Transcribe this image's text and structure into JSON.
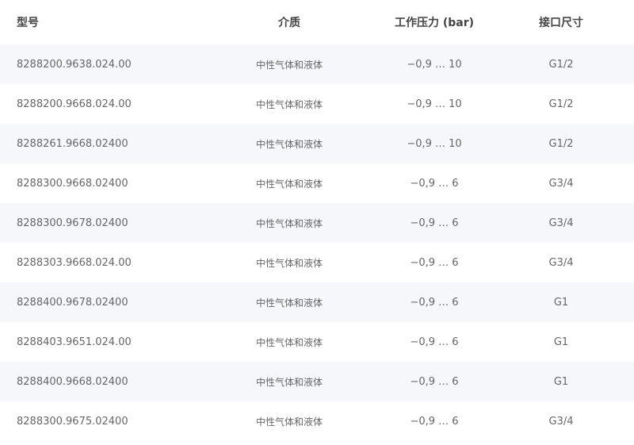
{
  "table": {
    "headers": [
      "型号",
      "介质",
      "工作压力 (bar)",
      "接口尺寸"
    ],
    "rows": [
      [
        "8288200.9638.024.00",
        "中性气体和液体",
        "−0,9 … 10",
        "G1/2"
      ],
      [
        "8288200.9668.024.00",
        "中性气体和液体",
        "−0,9 … 10",
        "G1/2"
      ],
      [
        "8288261.9668.02400",
        "中性气体和液体",
        "−0,9 … 10",
        "G1/2"
      ],
      [
        "8288300.9668.02400",
        "中性气体和液体",
        "−0,9 … 6",
        "G3/4"
      ],
      [
        "8288300.9678.02400",
        "中性气体和液体",
        "−0,9 … 6",
        "G3/4"
      ],
      [
        "8288303.9668.024.00",
        "中性气体和液体",
        "−0,9 … 6",
        "G3/4"
      ],
      [
        "8288400.9678.02400",
        "中性气体和液体",
        "−0,9 … 6",
        "G1"
      ],
      [
        "8288403.9651.024.00",
        "中性气体和液体",
        "−0,9 … 6",
        "G1"
      ],
      [
        "8288400.9668.02400",
        "中性气体和液体",
        "−0,9 … 6",
        "G1"
      ],
      [
        "8288300.9675.02400",
        "中性气体和液体",
        "−0,9 … 6",
        "G3/4"
      ]
    ]
  }
}
